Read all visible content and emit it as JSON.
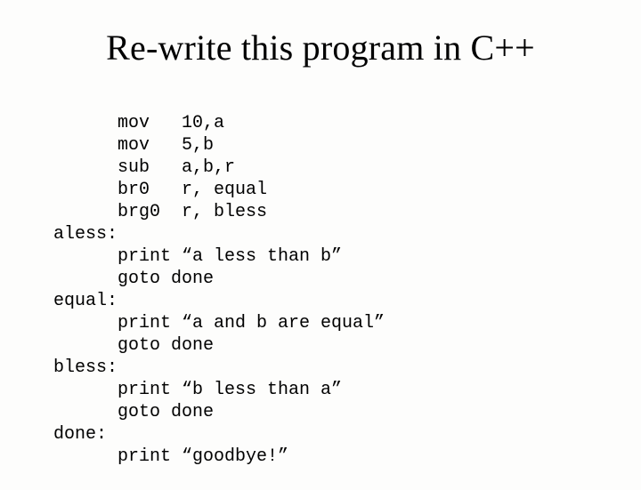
{
  "title": "Re-write this program in C++",
  "code": {
    "l1": "      mov   10,a",
    "l2": "      mov   5,b",
    "l3": "      sub   a,b,r",
    "l4": "      br0   r, equal",
    "l5": "      brg0  r, bless",
    "l6": "aless:",
    "l7": "      print “a less than b”",
    "l8": "      goto done",
    "l9": "equal:",
    "l10": "      print “a and b are equal”",
    "l11": "      goto done",
    "l12": "bless:",
    "l13": "      print “b less than a”",
    "l14": "      goto done",
    "l15": "done:",
    "l16": "      print “goodbye!”"
  }
}
